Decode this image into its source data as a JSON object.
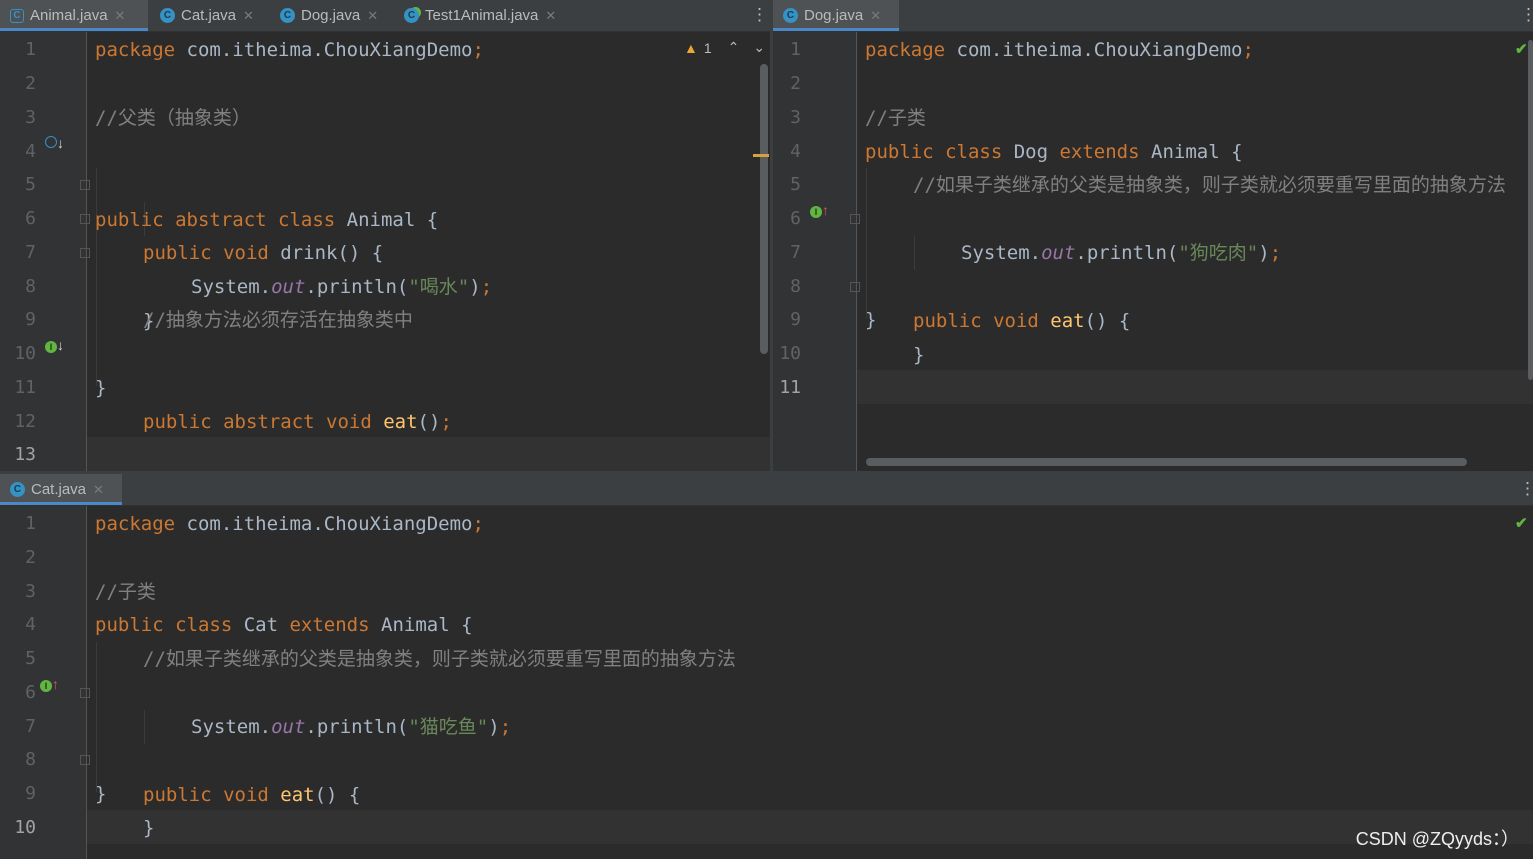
{
  "left_pane": {
    "tabs": [
      {
        "label": "Animal.java",
        "icon": "abstract-class-icon",
        "active": true
      },
      {
        "label": "Cat.java",
        "icon": "class-icon",
        "active": false
      },
      {
        "label": "Dog.java",
        "icon": "class-icon",
        "active": false
      },
      {
        "label": "Test1Animal.java",
        "icon": "runnable-class-icon",
        "active": false
      }
    ],
    "warning_count": "1",
    "line_numbers": [
      "1",
      "2",
      "3",
      "4",
      "5",
      "6",
      "7",
      "8",
      "9",
      "10",
      "11",
      "12",
      "13"
    ],
    "code": {
      "l1_kw": "package",
      "l1_rest": " com.itheima.ChouXiangDemo",
      "l1_semi": ";",
      "l3": "//父类（抽象类）",
      "l4_kw": "public abstract class",
      "l4_rest": " Animal {",
      "l5_kw": "public void",
      "l5_rest": " drink() {",
      "l6_a": "System.",
      "l6_out": "out",
      "l6_b": ".println(",
      "l6_str": "\"喝水\"",
      "l6_c": ")",
      "l6_semi": ";",
      "l7": "}",
      "l9": "//抽象方法必须存活在抽象类中",
      "l10_kw": "public abstract void",
      "l10_fn": " eat",
      "l10_rest": "()",
      "l10_semi": ";",
      "l11": "}"
    }
  },
  "right_pane": {
    "tabs": [
      {
        "label": "Dog.java",
        "icon": "class-icon",
        "active": true
      }
    ],
    "line_numbers": [
      "1",
      "2",
      "3",
      "4",
      "5",
      "6",
      "7",
      "8",
      "9",
      "10",
      "11"
    ],
    "code": {
      "l1_kw": "package",
      "l1_rest": " com.itheima.ChouXiangDemo",
      "l1_semi": ";",
      "l3": "//子类",
      "l4_kw1": "public class",
      "l4_name": " Dog ",
      "l4_kw2": "extends",
      "l4_rest": " Animal {",
      "l5": "//如果子类继承的父类是抽象类，则子类就必须要重写里面的抽象方法",
      "l6_kw": "public void",
      "l6_fn": " eat",
      "l6_rest": "() {",
      "l7_a": "System.",
      "l7_out": "out",
      "l7_b": ".println(",
      "l7_str": "\"狗吃肉\"",
      "l7_c": ")",
      "l7_semi": ";",
      "l8": "}",
      "l9": "}"
    }
  },
  "bottom_pane": {
    "tabs": [
      {
        "label": "Cat.java",
        "icon": "class-icon",
        "active": true
      }
    ],
    "line_numbers": [
      "1",
      "2",
      "3",
      "4",
      "5",
      "6",
      "7",
      "8",
      "9",
      "10"
    ],
    "code": {
      "l1_kw": "package",
      "l1_rest": " com.itheima.ChouXiangDemo",
      "l1_semi": ";",
      "l3": "//子类",
      "l4_kw1": "public class",
      "l4_name": " Cat ",
      "l4_kw2": "extends",
      "l4_rest": " Animal {",
      "l5": "//如果子类继承的父类是抽象类，则子类就必须要重写里面的抽象方法",
      "l6_kw": "public void",
      "l6_fn": " eat",
      "l6_rest": "() {",
      "l7_a": "System.",
      "l7_out": "out",
      "l7_b": ".println(",
      "l7_str": "\"猫吃鱼\"",
      "l7_c": ")",
      "l7_semi": ";",
      "l8": "}",
      "l9": "}"
    }
  },
  "watermark": "CSDN @ZQyyds：）",
  "colors": {
    "keyword": "#cc7832",
    "function": "#ffc66d",
    "string": "#6a8759",
    "comment": "#808080",
    "static_field": "#9876aa",
    "text": "#a9b7c6",
    "background": "#2b2b2b",
    "gutter": "#313335",
    "tab_accent": "#4a88c7"
  }
}
